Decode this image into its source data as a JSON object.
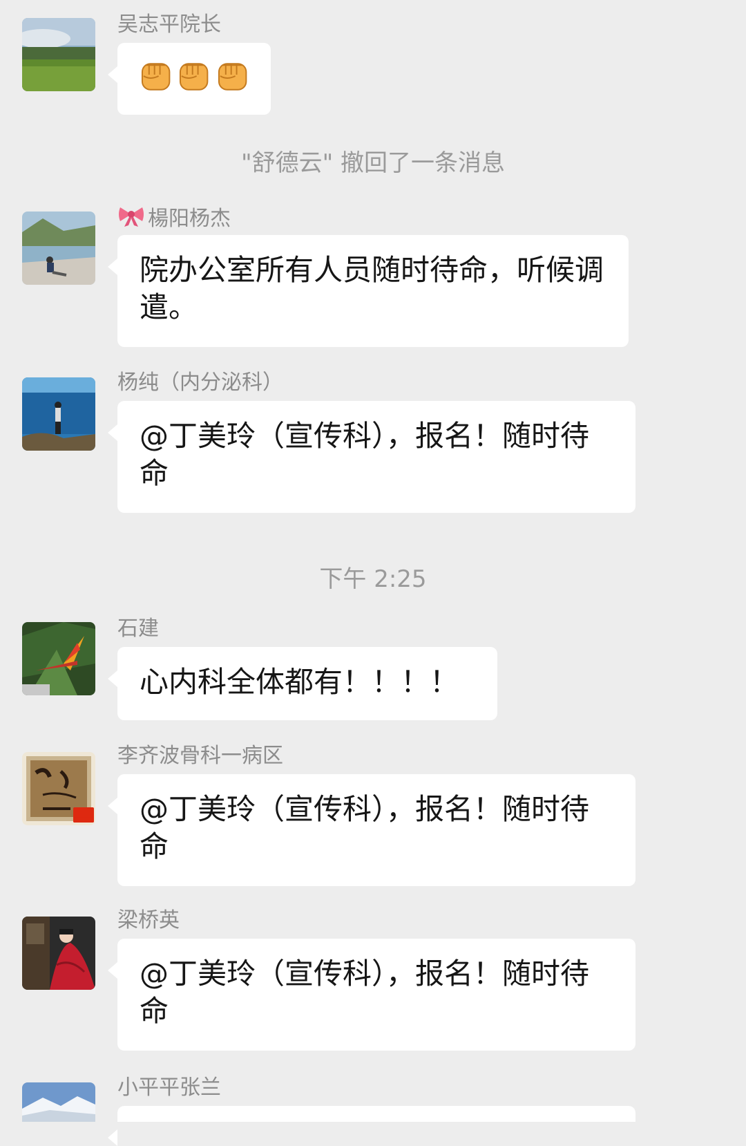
{
  "chat": {
    "messages": [
      {
        "sender": "吴志平院长",
        "content_type": "emoji",
        "emoji": [
          "fist-icon",
          "fist-icon",
          "fist-icon"
        ]
      },
      {
        "system": "\"舒德云\" 撤回了一条消息"
      },
      {
        "sender": "楊阳杨杰",
        "sender_prefix_icon": "ribbon-icon",
        "text": "院办公室所有人员随时待命，听候调遣。"
      },
      {
        "sender": "杨纯（内分泌科）",
        "text": "@丁美玲（宣传科），报名！随时待命"
      },
      {
        "timestamp": "下午 2:25"
      },
      {
        "sender": "石建",
        "text": "心内科全体都有！！！！"
      },
      {
        "sender": "李齐波骨科一病区",
        "text": "@丁美玲（宣传科），报名！随时待命"
      },
      {
        "sender": "梁桥英",
        "text": "@丁美玲（宣传科），报名！随时待命"
      },
      {
        "sender": "小平平张兰",
        "text": ""
      }
    ]
  },
  "colors": {
    "background": "#ededed",
    "bubble": "#ffffff",
    "sender_text": "#8c8c8c",
    "system_text": "#9a9a9a",
    "message_text": "#161616"
  }
}
